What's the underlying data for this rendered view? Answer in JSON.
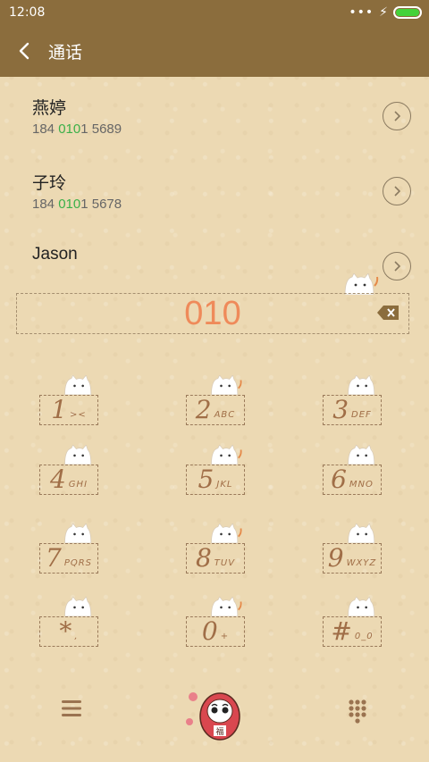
{
  "status": {
    "time": "12:08",
    "signal": "•••",
    "charging": "⚡"
  },
  "header": {
    "title": "通话"
  },
  "contacts": [
    {
      "name": "燕婷",
      "prefix": "184 ",
      "match": "010",
      "suffix": "1 5689"
    },
    {
      "name": "子玲",
      "prefix": "184 ",
      "match": "010",
      "suffix": "1 5678"
    },
    {
      "name": "Jason"
    }
  ],
  "dialer": {
    "digits": "010",
    "keys": [
      {
        "digit": "1",
        "letters": "><"
      },
      {
        "digit": "2",
        "letters": "ABC"
      },
      {
        "digit": "3",
        "letters": "DEF"
      },
      {
        "digit": "4",
        "letters": "GHI"
      },
      {
        "digit": "5",
        "letters": "JKL"
      },
      {
        "digit": "6",
        "letters": "MNO"
      },
      {
        "digit": "7",
        "letters": "PQRS"
      },
      {
        "digit": "8",
        "letters": "TUV"
      },
      {
        "digit": "9",
        "letters": "WXYZ"
      },
      {
        "digit": "*",
        "letters": ","
      },
      {
        "digit": "0",
        "letters": "+"
      },
      {
        "digit": "#",
        "letters": "0_0"
      }
    ]
  },
  "colors": {
    "bar": "#8b6d3d",
    "accent": "#ef8a5a",
    "match": "#3bb04a",
    "key": "#a06e47"
  },
  "icons": {
    "back": "back-arrow-icon",
    "detail": "chevron-right-icon",
    "delete": "backspace-icon",
    "menu": "menu-icon",
    "call": "daruma-call-icon",
    "dialpad": "dialpad-icon"
  }
}
